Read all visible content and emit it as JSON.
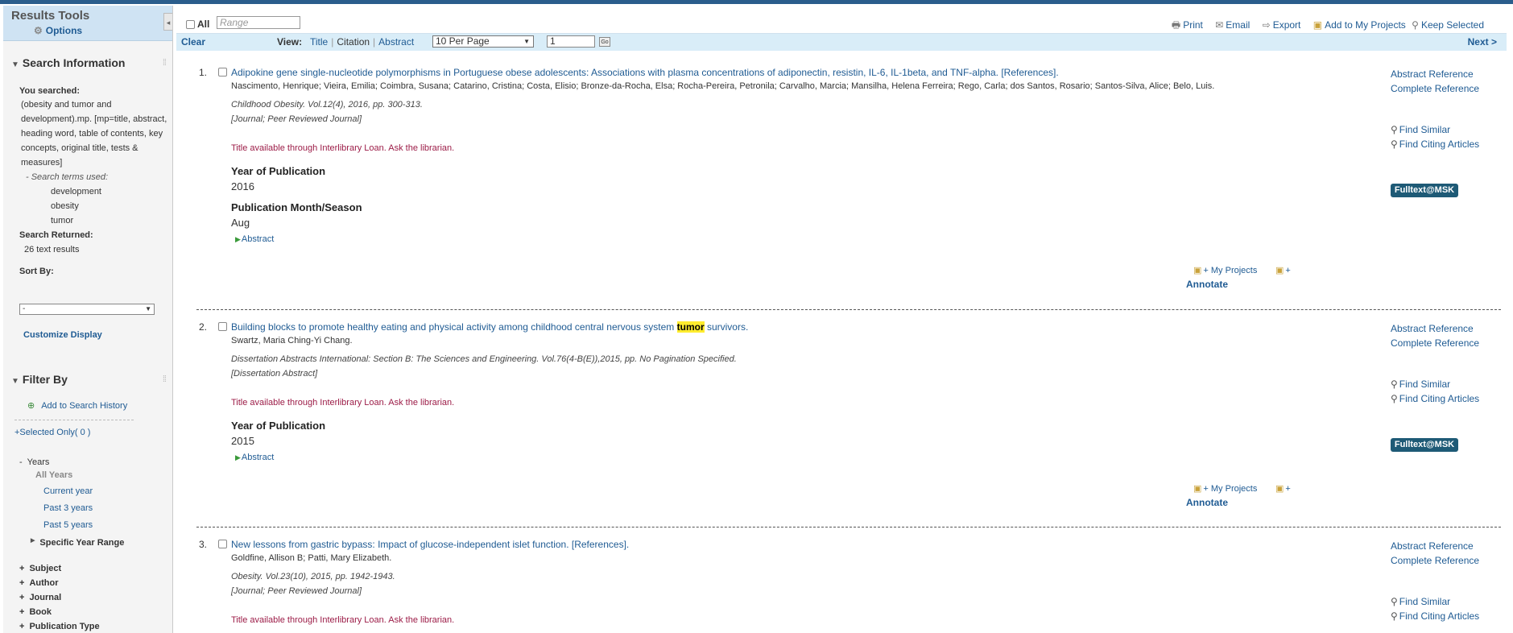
{
  "sidebar": {
    "title": "Results Tools",
    "options": "Options",
    "collapse": "◂",
    "search_info": {
      "heading": "Search Information",
      "you_searched_label": "You searched:",
      "query_lines": [
        "(obesity and tumor and",
        "development).mp. [mp=title, abstract,",
        "heading word, table of contents, key",
        "concepts, original title, tests &",
        "measures]"
      ],
      "terms_used_label": "- Search terms used:",
      "terms": [
        "development",
        "obesity",
        "tumor"
      ],
      "returned_label": "Search Returned:",
      "returned_value": "26 text results",
      "sort_label": "Sort By:",
      "sort_value": "-",
      "customize": "Customize Display"
    },
    "filter": {
      "heading": "Filter By",
      "add_history": "Add to Search History",
      "selected_only": "+Selected Only( 0 )",
      "years": {
        "label": "Years",
        "all": "All Years",
        "current": "Current year",
        "past3": "Past 3 years",
        "past5": "Past 5 years",
        "specific": "Specific Year Range"
      },
      "facets": [
        "Subject",
        "Author",
        "Journal",
        "Book",
        "Publication Type"
      ]
    }
  },
  "toolbar": {
    "all_label": "All",
    "range_placeholder": "Range",
    "print": "Print",
    "email": "Email",
    "export": "Export",
    "add_projects": "Add to My Projects",
    "keep_selected": "Keep Selected",
    "clear": "Clear",
    "view_label": "View:",
    "view_title": "Title",
    "view_citation": "Citation",
    "view_abstract": "Abstract",
    "per_page": "10 Per Page",
    "page": "1",
    "go": "Go",
    "next": "Next >"
  },
  "result_links": {
    "abstract_ref": "Abstract Reference",
    "complete_ref": "Complete Reference",
    "find_similar": "Find Similar",
    "find_citing": "Find Citing Articles",
    "fulltext": "Fulltext@MSK",
    "my_projects": "+ My Projects",
    "plus": "+",
    "annotate": "Annotate",
    "abstract": "Abstract",
    "ill": "Title available through Interlibrary Loan. Ask the librarian.",
    "year_label": "Year of Publication",
    "month_label": "Publication Month/Season"
  },
  "results": [
    {
      "num": "1.",
      "title": "Adipokine gene single-nucleotide polymorphisms in Portuguese obese adolescents: Associations with plasma concentrations of adiponectin, resistin, IL-6, IL-1beta, and TNF-alpha. [References].",
      "authors": "Nascimento, Henrique; Vieira, Emilia; Coimbra, Susana; Catarino, Cristina; Costa, Elisio; Bronze-da-Rocha, Elsa; Rocha-Pereira, Petronila; Carvalho, Marcia; Mansilha, Helena Ferreira; Rego, Carla; dos Santos, Rosario; Santos-Silva, Alice; Belo, Luis.",
      "source": "Childhood Obesity. Vol.12(4), 2016, pp. 300-313.",
      "type": "[Journal; Peer Reviewed Journal]",
      "year": "2016",
      "month": "Aug"
    },
    {
      "num": "2.",
      "title_pre": "Building blocks to promote healthy eating and physical activity among childhood central nervous system ",
      "title_hl": "tumor",
      "title_post": " survivors.",
      "authors": "Swartz, Maria Ching-Yi Chang.",
      "source": "Dissertation Abstracts International: Section B: The Sciences and Engineering. Vol.76(4-B(E)),2015, pp. No Pagination Specified.",
      "type": "[Dissertation Abstract]",
      "year": "2015"
    },
    {
      "num": "3.",
      "title": "New lessons from gastric bypass: Impact of glucose-independent islet function. [References].",
      "authors": "Goldfine, Allison B; Patti, Mary Elizabeth.",
      "source": "Obesity. Vol.23(10), 2015, pp. 1942-1943.",
      "type": "[Journal; Peer Reviewed Journal]"
    }
  ]
}
